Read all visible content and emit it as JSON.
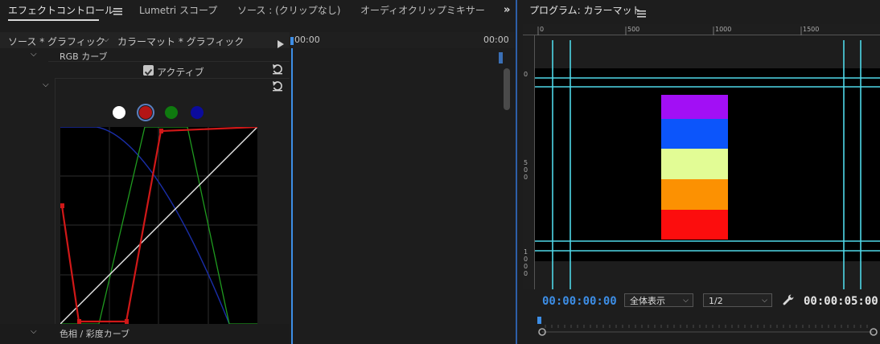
{
  "tabs": {
    "effect_controls": "エフェクトコントロール",
    "lumetri_scope": "Lumetri スコープ",
    "source": "ソース : (クリップなし)",
    "audio_mixer": "オーディオクリップミキサー : カ",
    "program": "プログラム: カラーマット"
  },
  "effect_controls": {
    "source_label": "ソース * グラフィック",
    "sequence_label": "カラーマット * グラフィック",
    "rgb_curves": "RGB カーブ",
    "active_label": "アクティブ",
    "hue_sat_curves": "色相 / 彩度カーブ",
    "timeline_start": "00:00",
    "timeline_end": "00:00"
  },
  "channels": {
    "white": "#ffffff",
    "red": "#b31515",
    "green": "#0f7a0f",
    "blue": "#0b0b9c"
  },
  "program": {
    "ruler": [
      "0",
      "500",
      "1000",
      "1500"
    ],
    "vruler": [
      [
        "0"
      ],
      [
        "5",
        "0",
        "0"
      ],
      [
        "1",
        "0",
        "0",
        "0"
      ]
    ],
    "timecode_current": "00:00:00:00",
    "timecode_duration": "00:00:05:00",
    "fit_select": "全体表示",
    "resolution_select": "1/2",
    "color_bars": [
      "#a20ff5",
      "#0c55fb",
      "#e2fc95",
      "#fc9102",
      "#fc0d0d"
    ]
  }
}
